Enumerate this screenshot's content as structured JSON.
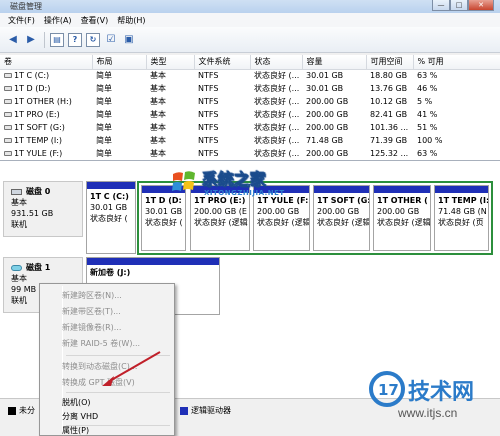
{
  "window": {
    "title": "磁盘管理",
    "minimize": "—",
    "maximize": "□",
    "close": "✕"
  },
  "menubar": {
    "items": [
      "文件(F)",
      "操作(A)",
      "查看(V)",
      "帮助(H)"
    ]
  },
  "toolbar": {
    "back_icon": "back-arrow-icon",
    "forward_icon": "forward-arrow-icon",
    "buttons": [
      "properties-icon",
      "help-icon",
      "refresh-icon",
      "check-icon",
      "console-icon"
    ]
  },
  "volume_table": {
    "headers": [
      "卷",
      "布局",
      "类型",
      "文件系统",
      "状态",
      "容量",
      "可用空间",
      "% 可用"
    ],
    "rows": [
      [
        "1T C (C:)",
        "简单",
        "基本",
        "NTFS",
        "状态良好 (...",
        "30.01 GB",
        "18.80 GB",
        "63 %"
      ],
      [
        "1T D (D:)",
        "简单",
        "基本",
        "NTFS",
        "状态良好 (...",
        "30.01 GB",
        "13.76 GB",
        "46 %"
      ],
      [
        "1T OTHER (H:)",
        "简单",
        "基本",
        "NTFS",
        "状态良好 (...",
        "200.00 GB",
        "10.12 GB",
        "5 %"
      ],
      [
        "1T PRO (E:)",
        "简单",
        "基本",
        "NTFS",
        "状态良好 (...",
        "200.00 GB",
        "82.41 GB",
        "41 %"
      ],
      [
        "1T SOFT (G:)",
        "简单",
        "基本",
        "NTFS",
        "状态良好 (...",
        "200.00 GB",
        "101.36 ...",
        "51 %"
      ],
      [
        "1T TEMP (I:)",
        "简单",
        "基本",
        "NTFS",
        "状态良好 (...",
        "71.48 GB",
        "71.39 GB",
        "100 %"
      ],
      [
        "1T YULE (F:)",
        "简单",
        "基本",
        "NTFS",
        "状态良好 (...",
        "200.00 GB",
        "125.32 ...",
        "63 %"
      ]
    ]
  },
  "disks": [
    {
      "name": "磁盘 0",
      "type": "基本",
      "size": "931.51 GB",
      "status": "联机",
      "partitions": [
        {
          "name": "1T C (C:)",
          "size": "30.01 GB",
          "status": "状态良好 ("
        },
        {
          "name": "1T D (D:",
          "size": "30.01 GB",
          "status": "状态良好 ("
        },
        {
          "name": "1T PRO (E:)",
          "size": "200.00 GB (E",
          "status": "状态良好 (逻辑"
        },
        {
          "name": "1T YULE (F:",
          "size": "200.00 GB",
          "status": "状态良好 (逻辑"
        },
        {
          "name": "1T SOFT (G:",
          "size": "200.00 GB",
          "status": "状态良好 (逻辑"
        },
        {
          "name": "1T OTHER (",
          "size": "200.00 GB",
          "status": "状态良好 (逻辑"
        },
        {
          "name": "1T TEMP (I:",
          "size": "71.48 GB (N",
          "status": "状态良好 (页"
        }
      ]
    },
    {
      "name": "磁盘 1",
      "type": "基本",
      "size": "99 MB",
      "status": "联机",
      "partitions": [
        {
          "name": "新加卷 (J:)",
          "size": "",
          "status": ""
        }
      ]
    }
  ],
  "context_menu": {
    "items": [
      {
        "label": "新建跨区卷(N)...",
        "enabled": false
      },
      {
        "label": "新建带区卷(T)...",
        "enabled": false
      },
      {
        "label": "新建镜像卷(R)...",
        "enabled": false
      },
      {
        "label": "新建 RAID-5 卷(W)...",
        "enabled": false
      },
      {
        "label": "转换到动态磁盘(C)...",
        "enabled": false
      },
      {
        "label": "转换成 GPT 磁盘(V)",
        "enabled": false
      },
      {
        "label": "脱机(O)",
        "enabled": true
      },
      {
        "label": "分离 VHD",
        "enabled": true
      },
      {
        "label": "属性(P)",
        "enabled": true
      }
    ]
  },
  "legend": {
    "unallocated": "未分",
    "logical_drive": "逻辑驱动器",
    "colors": {
      "unallocated": "#000000",
      "primary": "#1f2fb7",
      "extended": "#2c8f3c",
      "logical": "#1f2fb7"
    }
  },
  "watermarks": {
    "site1_name": "系统之家",
    "site1_url": "XITONGZHIJIA.NET",
    "site2_name": "技术网",
    "site2_logo": "17",
    "site2_url": "www.itjs.cn"
  },
  "colors": {
    "accent": "#1f2fb7",
    "extended_border": "#2c8f3c",
    "arrow": "#c0202a"
  }
}
